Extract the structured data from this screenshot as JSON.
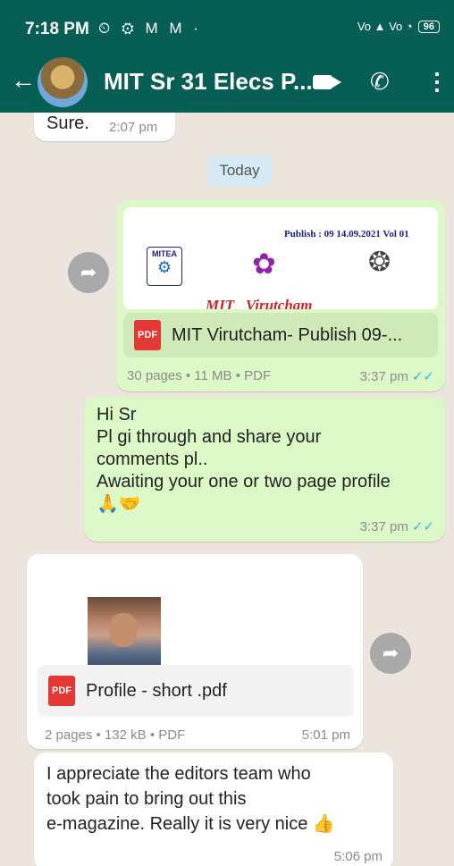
{
  "status": {
    "time": "7:18 PM",
    "left_icons": "⏲ ⚙ M M ·",
    "right_icons": "Vo ▲ Vo ◔",
    "battery": "96"
  },
  "header": {
    "title": "MIT Sr 31 Elecs P..."
  },
  "messages": {
    "m0": {
      "text": "Sure.",
      "time": "2:07 pm"
    },
    "date_chip": "Today",
    "m1": {
      "preview_header": "Publish : 09   14.09.2021 Vol 01",
      "logo_label": "MITEA",
      "preview_words": "MIT   Virutcham",
      "doc_name": "MIT Virutcham- Publish 09-...",
      "meta": "30 pages • 11 MB • PDF",
      "time": "3:37 pm"
    },
    "m2": {
      "lines": [
        "Hi Sr",
        "Pl gi through and share your",
        "comments pl..",
        "Awaiting your one or two page profile"
      ],
      "emoji": "🙏🤝",
      "time": "3:37 pm"
    },
    "m3": {
      "doc_name": "Profile - short .pdf",
      "meta": "2 pages • 132 kB • PDF",
      "time": "5:01 pm"
    },
    "m4": {
      "lines": [
        "I appreciate the editors team who",
        "took pain to bring out this",
        "e-magazine. Really it is very nice 👍"
      ],
      "time": "5:06 pm"
    }
  },
  "colors": {
    "header": "#075e54",
    "outgoing": "#dcf8c6",
    "incoming": "#ffffff",
    "ticks": "#34b7f1"
  }
}
